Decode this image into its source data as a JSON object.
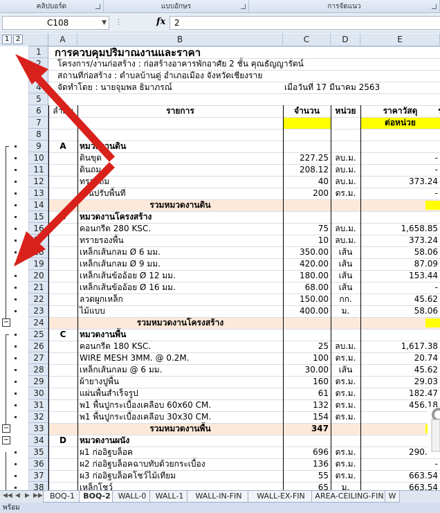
{
  "ribbon": {
    "groups": [
      "คลิปบอร์ด",
      "แบบอักษร",
      "การจัดแนว"
    ]
  },
  "formula_bar": {
    "name_box": "C108",
    "fx_label": "fx",
    "value": "2"
  },
  "outline": {
    "level_buttons": [
      "1",
      "2"
    ]
  },
  "columns": [
    "A",
    "B",
    "C",
    "D",
    "E"
  ],
  "rows": [
    "1",
    "2",
    "3",
    "4",
    "5",
    "6",
    "7",
    "8",
    "9",
    "10",
    "11",
    "12",
    "13",
    "14",
    "15",
    "16",
    "17",
    "18",
    "19",
    "20",
    "21",
    "22",
    "23",
    "24",
    "25",
    "26",
    "27",
    "28",
    "29",
    "30",
    "31",
    "32",
    "33",
    "34",
    "35",
    "36",
    "37",
    "38"
  ],
  "sheet": {
    "title": "การควบคุมปริมาณงานและราคา",
    "project_line": "โครงการ/งานก่อสร้าง  :  ก่อสร้างอาคารพักอาศัย 2 ชั้น คุณธัญญารัตน์",
    "location_line": "สถานที่ก่อสร้าง  :  ตำบลบ้านดู่ อำเภอเมือง จังหวัดเชียงราย",
    "prepared_line": "จัดทำโดย  :  นายจุมพล  ธิมาภรณ์",
    "date_line": "เมื่อวันที่  17 มีนาคม 2563",
    "header": {
      "seq": "ลำดับ",
      "item": "รายการ",
      "qty": "จำนวน",
      "unit": "หน่วย",
      "material_price": "ราคาวัสดุ",
      "per_unit": "ต่อหน่วย",
      "extra": "ร"
    },
    "table_rows": [
      {
        "row": "9",
        "a": "A",
        "b": "หมวดงานดิน",
        "c": "",
        "d": "",
        "e": "",
        "kind": "section"
      },
      {
        "row": "10",
        "a": "",
        "b": "ดินขุด",
        "c": "227.25",
        "d": "ลบ.ม.",
        "e": "-",
        "kind": "item"
      },
      {
        "row": "11",
        "a": "",
        "b": "ดินถม",
        "c": "208.12",
        "d": "ลบ.ม.",
        "e": "-",
        "kind": "item"
      },
      {
        "row": "12",
        "a": "",
        "b": "ทรายถม",
        "c": "40",
        "d": "ลบ.ม.",
        "e": "373.24",
        "kind": "item"
      },
      {
        "row": "13",
        "a": "",
        "b": "งานปรับพื้นที่",
        "c": "200",
        "d": "ตร.ม.",
        "e": "-",
        "kind": "item"
      },
      {
        "row": "14",
        "a": "",
        "b": "รวมหมวดงานดิน",
        "c": "",
        "d": "",
        "e": "",
        "kind": "total"
      },
      {
        "row": "15",
        "a": "B",
        "b": "หมวดงานโครงสร้าง",
        "c": "",
        "d": "",
        "e": "",
        "kind": "section"
      },
      {
        "row": "16",
        "a": "",
        "b": "คอนกรีต 280 KSC.",
        "c": "75",
        "d": "ลบ.ม.",
        "e": "1,658.85",
        "kind": "item"
      },
      {
        "row": "17",
        "a": "",
        "b": "ทรายรองพื้น",
        "c": "10",
        "d": "ลบ.ม.",
        "e": "373.24",
        "kind": "item"
      },
      {
        "row": "18",
        "a": "",
        "b": "เหล็กเส้นกลม  Ø   6 มม.",
        "c": "350.00",
        "d": "เส้น",
        "e": "58.06",
        "kind": "item"
      },
      {
        "row": "19",
        "a": "",
        "b": "เหล็กเส้นกลม    Ø   9 มม.",
        "c": "420.00",
        "d": "เส้น",
        "e": "87.09",
        "kind": "item"
      },
      {
        "row": "20",
        "a": "",
        "b": "เหล็กเส้นข้ออ้อย Ø  12 มม.",
        "c": "180.00",
        "d": "เส้น",
        "e": "153.44",
        "kind": "item"
      },
      {
        "row": "21",
        "a": "",
        "b": "เหล็กเส้นข้ออ้อย Ø  16 มม.",
        "c": "68.00",
        "d": "เส้น",
        "e": "-",
        "kind": "item"
      },
      {
        "row": "22",
        "a": "",
        "b": "ลวดผูกเหล็ก",
        "c": "150.00",
        "d": "กก.",
        "e": "45.62",
        "kind": "item"
      },
      {
        "row": "23",
        "a": "",
        "b": "ไม้แบบ",
        "c": "400.00",
        "d": "ม.",
        "e": "58.06",
        "kind": "item"
      },
      {
        "row": "24",
        "a": "",
        "b": "รวมหมวดงานโครงสร้าง",
        "c": "",
        "d": "",
        "e": "",
        "kind": "total"
      },
      {
        "row": "25",
        "a": "C",
        "b": "หมวดงานพื้น",
        "c": "",
        "d": "",
        "e": "",
        "kind": "section"
      },
      {
        "row": "26",
        "a": "",
        "b": "คอนกรีต 180 KSC.",
        "c": "25",
        "d": "ลบ.ม.",
        "e": "1,617.38",
        "kind": "item"
      },
      {
        "row": "27",
        "a": "",
        "b": "WIRE MESH 3MM. @ 0.2M.",
        "c": "100",
        "d": "ตร.ม.",
        "e": "20.74",
        "kind": "item"
      },
      {
        "row": "28",
        "a": "",
        "b": "เหล็กเส้นกลม    @   6 มม.",
        "c": "30.00",
        "d": "เส้น",
        "e": "45.62",
        "kind": "item"
      },
      {
        "row": "29",
        "a": "",
        "b": "ผ้ายางปูพื้น",
        "c": "160",
        "d": "ตร.ม.",
        "e": "29.03",
        "kind": "item"
      },
      {
        "row": "30",
        "a": "",
        "b": "แผ่นพื้นสำเร็จรูป",
        "c": "61",
        "d": "ตร.ม.",
        "e": "182.47",
        "kind": "item"
      },
      {
        "row": "31",
        "a": "",
        "b": "พ1 พื้นปูกระเบื้องเคลือบ 60x60 CM.",
        "c": "132",
        "d": "ตร.ม.",
        "e": "456.18",
        "kind": "item"
      },
      {
        "row": "32",
        "a": "",
        "b": "พ1 พื้นปูกระเบื้องเคลือบ 30x30 CM.",
        "c": "154",
        "d": "ตร.ม.",
        "e": "-",
        "kind": "item"
      },
      {
        "row": "33",
        "a": "",
        "b": "รวมหมวดงานพื้น",
        "c": "347",
        "d": "",
        "e": "",
        "kind": "total"
      },
      {
        "row": "34",
        "a": "D",
        "b": "หมวดงานผนัง",
        "c": "",
        "d": "",
        "e": "",
        "kind": "section"
      },
      {
        "row": "35",
        "a": "",
        "b": "ผ1 ก่ออิฐบล็อค",
        "c": "696",
        "d": "ตร.ม.",
        "e": "290.30",
        "kind": "item"
      },
      {
        "row": "36",
        "a": "",
        "b": "ผ2 ก่ออิฐบล็อคฉาบทับด้วยกระเบื้อง",
        "c": "136",
        "d": "ตร.ม.",
        "e": "-",
        "kind": "item"
      },
      {
        "row": "37",
        "a": "",
        "b": "ผ3 ก่ออิฐบล็อคโชว์ไม้เทียม",
        "c": "55",
        "d": "ตร.ม.",
        "e": "663.54",
        "kind": "item"
      },
      {
        "row": "38",
        "a": "",
        "b": "เหล็กโชว์",
        "c": "65",
        "d": "ม.",
        "e": "663.54",
        "kind": "item"
      }
    ]
  },
  "tabs": [
    {
      "label": "BOQ-1",
      "active": false
    },
    {
      "label": "BOQ-2",
      "active": true
    },
    {
      "label": "WALL-0",
      "active": false
    },
    {
      "label": "WALL-1",
      "active": false
    },
    {
      "label": "WALL-IN-FIN",
      "active": false
    },
    {
      "label": "WALL-EX-FIN",
      "active": false
    },
    {
      "label": "AREA-CEILING-FIN",
      "active": false
    },
    {
      "label": "W",
      "active": false
    }
  ],
  "status": {
    "text": "พร้อม"
  },
  "colors": {
    "arrow": "#d9211c",
    "total_row_fill": "#fde9d9",
    "yellow_fill": "#ffff00",
    "header_fill": "#dde6f1"
  },
  "icons": {
    "fx": "function-icon",
    "expand": "minus-icon",
    "launcher": "dialog-launcher-icon"
  }
}
